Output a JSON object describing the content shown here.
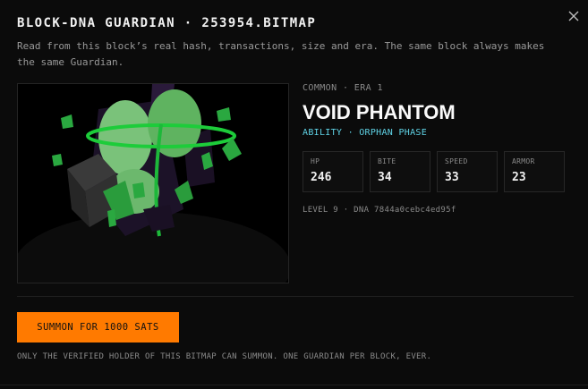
{
  "modal": {
    "title": "BLOCK-DNA GUARDIAN · 253954.BITMAP",
    "description": "Read from this block’s real hash, transactions, size and era. The same block always makes the same Guardian."
  },
  "icons": {
    "close": "close-icon"
  },
  "guardian": {
    "rarity_era": "COMMON · ERA 1",
    "name": "VOID PHANTOM",
    "ability": "ABILITY · ORPHAN PHASE",
    "stats": [
      {
        "label": "HP",
        "value": "246"
      },
      {
        "label": "BITE",
        "value": "34"
      },
      {
        "label": "SPEED",
        "value": "33"
      },
      {
        "label": "ARMOR",
        "value": "23"
      }
    ],
    "level_dna": "LEVEL 9 · DNA 7844a0cebc4ed95f"
  },
  "summon": {
    "button_label": "SUMMON FOR 1000 SATS",
    "footnote": "ONLY THE VERIFIED HOLDER OF THIS BITMAP CAN SUMMON. ONE GUARDIAN PER BLOCK, EVER."
  },
  "colors": {
    "accent": "#ff7a00",
    "ability": "#5fd3e6",
    "background": "#0b0b0b",
    "creature_green": "#2bbf45"
  }
}
